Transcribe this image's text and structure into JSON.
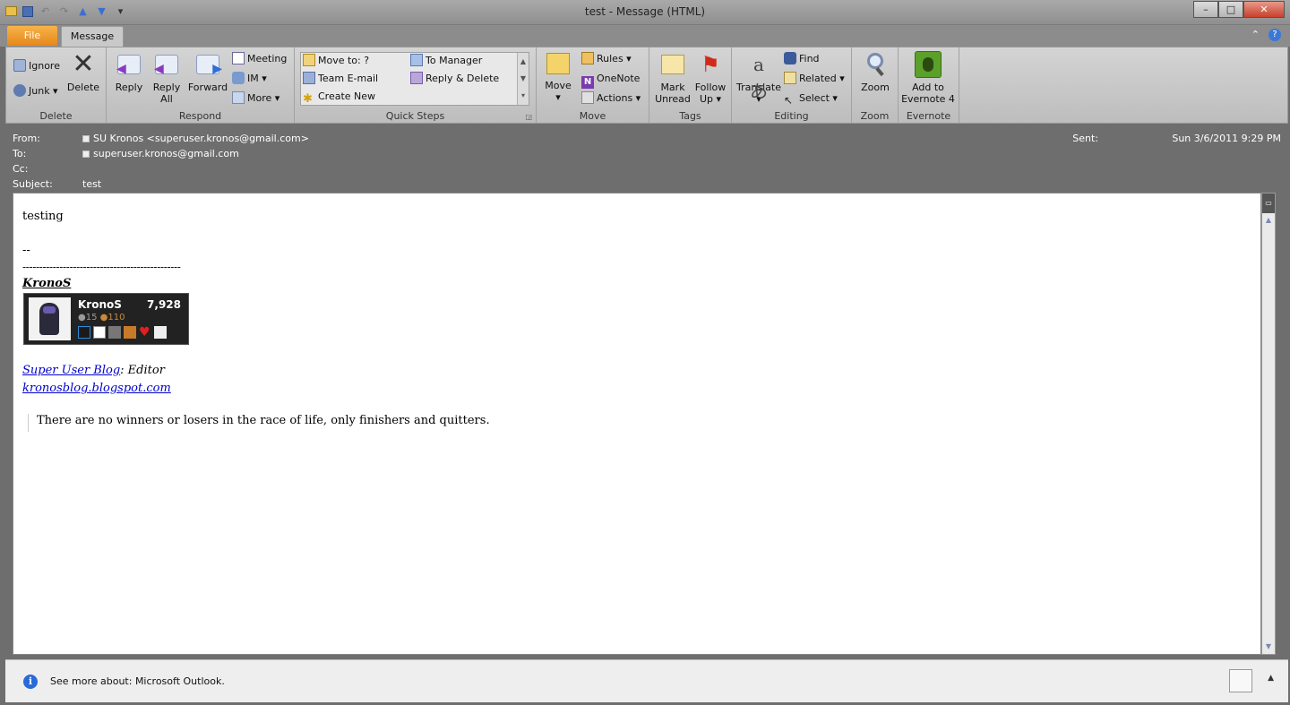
{
  "window": {
    "title": "test  -  Message (HTML)",
    "minimize": "–",
    "maximize": "□",
    "close": "✕"
  },
  "tabs": {
    "file": "File",
    "message": "Message"
  },
  "ribbon": {
    "delete": {
      "label": "Delete",
      "ignore": "Ignore",
      "junk": "Junk",
      "delete": "Delete"
    },
    "respond": {
      "label": "Respond",
      "reply": "Reply",
      "reply_all_1": "Reply",
      "reply_all_2": "All",
      "forward": "Forward",
      "meeting": "Meeting",
      "im": "IM",
      "more": "More"
    },
    "quick_steps": {
      "label": "Quick Steps",
      "move_to": "Move to: ?",
      "team_email": "Team E-mail",
      "create_new": "Create New",
      "to_manager": "To Manager",
      "reply_delete": "Reply & Delete"
    },
    "move": {
      "label": "Move",
      "move": "Move",
      "rules": "Rules",
      "onenote": "OneNote",
      "actions": "Actions"
    },
    "tags": {
      "label": "Tags",
      "mark_unread_1": "Mark",
      "mark_unread_2": "Unread",
      "follow_up_1": "Follow",
      "follow_up_2": "Up"
    },
    "editing": {
      "label": "Editing",
      "translate": "Translate",
      "find": "Find",
      "related": "Related",
      "select": "Select"
    },
    "zoom": {
      "label": "Zoom",
      "zoom": "Zoom"
    },
    "evernote": {
      "label": "Evernote",
      "add_1": "Add to",
      "add_2": "Evernote 4"
    }
  },
  "header": {
    "from_label": "From:",
    "from_value": "SU Kronos <superuser.kronos@gmail.com>",
    "to_label": "To:",
    "to_value": "superuser.kronos@gmail.com",
    "cc_label": "Cc:",
    "subject_label": "Subject:",
    "subject_value": "test",
    "sent_label": "Sent:",
    "sent_value": "Sun 3/6/2011 9:29 PM"
  },
  "message": {
    "line1": "testing",
    "sig_dash": "--",
    "sig_rule": "-----------------------------------------------",
    "name": "KronoS",
    "flair_name": "KronoS",
    "flair_rep": "7,928",
    "flair_silver": "●15",
    "flair_bronze": "●110",
    "blog_link": "Super User Blog",
    "blog_role": ": Editor",
    "blog_url": "kronosblog.blogspot.com",
    "quote": "There are no winners or losers in the race of life, only finishers and quitters."
  },
  "people_pane": {
    "text": "See more about: Microsoft Outlook."
  }
}
